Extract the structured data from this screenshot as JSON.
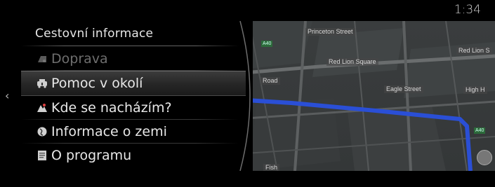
{
  "status": {
    "time": "1:34"
  },
  "menu": {
    "title": "Cestovní informace",
    "items": [
      {
        "label": "Doprava",
        "icon": "traffic-icon",
        "state": "disabled"
      },
      {
        "label": "Pomoc v okolí",
        "icon": "roadside-assistance-icon",
        "state": "selected"
      },
      {
        "label": "Kde se nacházím?",
        "icon": "location-pin-icon",
        "state": "normal"
      },
      {
        "label": "Informace o zemi",
        "icon": "country-info-icon",
        "state": "normal"
      },
      {
        "label": "O programu",
        "icon": "document-icon",
        "state": "normal"
      }
    ]
  },
  "map": {
    "street_labels": [
      "Princeton Street",
      "Red Lion Square",
      "Eagle Street",
      "Red Lion S",
      "High H",
      "Road",
      "Fish"
    ],
    "road_badges": [
      "A40",
      "A40"
    ],
    "route_color": "#2a4fd6"
  },
  "colors": {
    "background": "#000000",
    "text": "#e8e8e8",
    "disabled": "#6e6e6e"
  }
}
